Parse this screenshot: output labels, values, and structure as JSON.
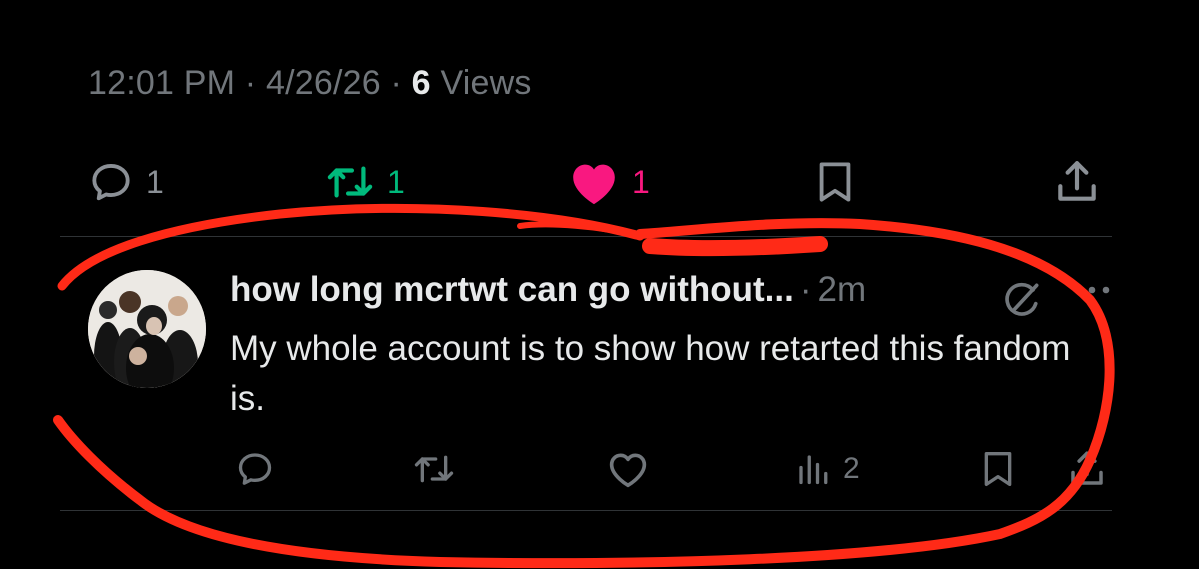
{
  "post": {
    "time": "12:01 PM",
    "date": "4/26/26",
    "views_count": "6",
    "views_label": "Views",
    "separator": "·"
  },
  "actions": {
    "reply_count": "1",
    "repost_count": "1",
    "like_count": "1"
  },
  "reply": {
    "name": "how long mcrtwt can go without...",
    "time_sep": "·",
    "time": "2m",
    "text": "My whole account is to show how retarted this fandom is.",
    "views_count": "2"
  },
  "colors": {
    "background": "#000000",
    "text_primary": "#e7e9ea",
    "text_secondary": "#71767b",
    "repost_green": "#00ba7c",
    "like_pink": "#f91880",
    "annotation_red": "#ff2a17"
  },
  "icons": [
    "reply-icon",
    "repost-icon",
    "like-icon",
    "bookmark-icon",
    "share-icon",
    "grok-icon",
    "more-icon",
    "views-icon"
  ]
}
